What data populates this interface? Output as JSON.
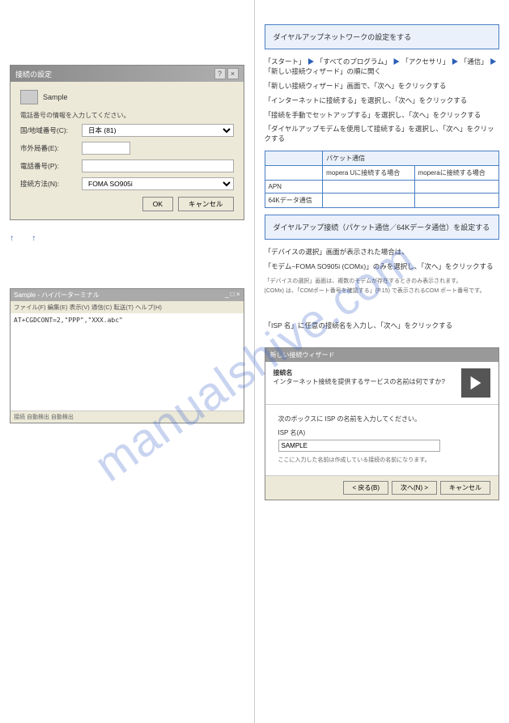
{
  "dialog1": {
    "title": "接続の設定",
    "sample": "Sample",
    "prompt": "電話番号の情報を入力してください。",
    "country_label": "国/地域番号(C):",
    "country_value": "日本 (81)",
    "area_label": "市外局番(E):",
    "area_value": "",
    "phone_label": "電話番号(P):",
    "phone_value": "",
    "connect_label": "接続方法(N):",
    "connect_value": "FOMA SO905i",
    "ok": "OK",
    "cancel": "キャンセル"
  },
  "left_steps": {
    "s1": "↑",
    "s2": "↑"
  },
  "terminal": {
    "title": "Sample - ハイパーターミナル",
    "menu": "ファイル(F) 編集(E) 表示(V) 通信(C) 転送(T) ヘルプ(H)",
    "cmd": "AT+CGDCONT=2,\"PPP\",\"XXX.abc\"",
    "status": "接続 自動検出 自動検出"
  },
  "right_top": {
    "box1": "ダイヤルアップネットワークの設定をする"
  },
  "right_steps": {
    "s1_a": "「スタート」",
    "s1_b": "「すべてのプログラム」",
    "s1_c": "「アクセサリ」",
    "s1_d": "「通信」",
    "s1_e": "「新しい接続ウィザード」の順に開く",
    "s2": "「新しい接続ウィザード」画面で、「次へ」をクリックする",
    "s3": "「インターネットに接続する」を選択し、「次へ」をクリックする",
    "s4": "「接続を手動でセットアップする」を選択し、「次へ」をクリックする",
    "s5": "「ダイヤルアップモデムを使用して接続する」を選択し、「次へ」をクリックする",
    "s6_title": "「デバイスの選択」画面が表示された場合は、",
    "s6_body": "「モデム−FOMA SO905i (COMx)」のみを選択し、「次へ」をクリックする"
  },
  "table": {
    "h1": "",
    "h2": "パケット通信",
    "c1": "mopera Uに接続する場合",
    "c2": "moperaに接続する場合",
    "r1": "APN",
    "r1v1": "",
    "r1v2": "",
    "r2": "64Kデータ通信",
    "r2v1": "",
    "r2v2": ""
  },
  "blue_box2": {
    "l1": "ダイヤルアップ接続（パケット通信／64Kデータ通信）を設定する",
    "l2": ""
  },
  "wizard": {
    "titlebar": "新しい接続ウィザード",
    "header_title": "接続名",
    "header_sub": "インターネット接続を提供するサービスの名前は何ですか?",
    "body_prompt": "次のボックスに ISP の名前を入力してください。",
    "isp_label": "ISP 名(A)",
    "isp_value": "SAMPLE",
    "note": "ここに入力した名前は作成している接続の名前になります。",
    "back": "< 戻る(B)",
    "next": "次へ(N) >",
    "cancel": "キャンセル"
  },
  "body_notes": {
    "n1": "「デバイスの選択」画面は、複数のモデムが存在するときのみ表示されます。",
    "n2": "(COMx) は、「COMポート番号を確認する」(P.15) で表示されるCOM ポート番号です。",
    "n7": "「ISP 名」に任意の接続名を入力し、「次へ」をクリックする"
  }
}
